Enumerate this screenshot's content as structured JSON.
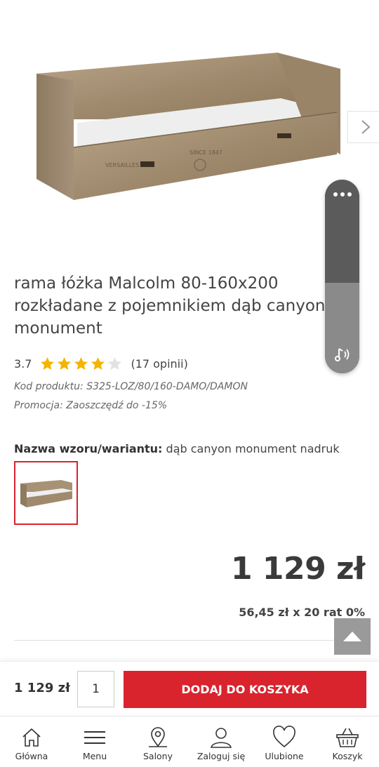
{
  "product": {
    "title": "rama łóżka Malcolm 80-160x200 rozkładane z pojemnikiem dąb canyon monument",
    "rating": "3.7",
    "rating_stars": 3.7,
    "reviews": "(17 opinii)",
    "code": "Kod produktu: S325-LOZ/80/160-DAMO/DAMON",
    "promo": "Promocja: Zaoszczędź do -15%"
  },
  "variant": {
    "label": "Nazwa wzoru/wariantu:",
    "value": "dąb canyon monument nadruk"
  },
  "pricing": {
    "price": "1 129 zł",
    "installments": "56,45 zł x 20 rat 0%"
  },
  "buybar": {
    "price": "1 129 zł",
    "quantity": "1",
    "add_label": "DODAJ DO KOSZYKA"
  },
  "nav": {
    "items": [
      {
        "label": "Główna",
        "icon": "home-icon"
      },
      {
        "label": "Menu",
        "icon": "menu-icon"
      },
      {
        "label": "Salony",
        "icon": "map-pin-icon"
      },
      {
        "label": "Zaloguj się",
        "icon": "user-icon"
      },
      {
        "label": "Ulubione",
        "icon": "heart-icon"
      },
      {
        "label": "Koszyk",
        "icon": "basket-icon"
      }
    ]
  },
  "colors": {
    "accent": "#d9232d",
    "star": "#f4b400",
    "text": "#333333"
  }
}
